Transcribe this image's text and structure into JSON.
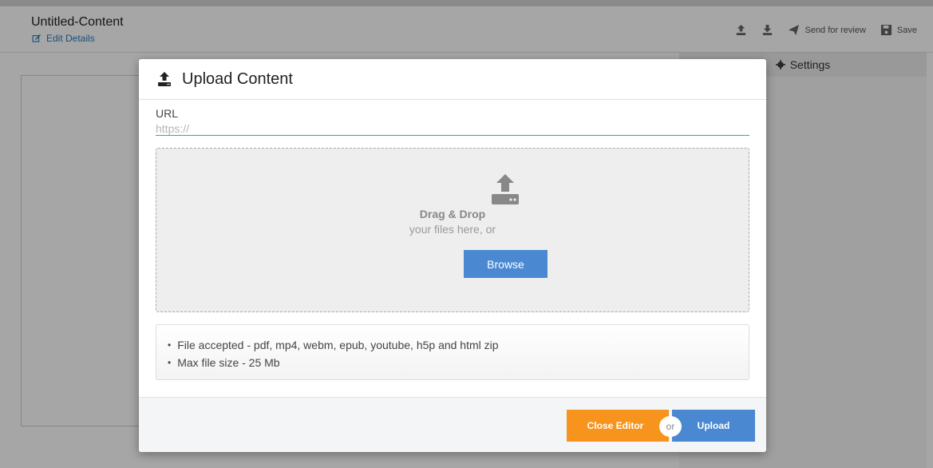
{
  "editor": {
    "title": "Untitled-Content",
    "edit_details": "Edit Details",
    "toolbar": {
      "upload_icon": "upload-icon",
      "download_icon": "download-icon",
      "send_for_review": "Send for review",
      "save": "Save"
    },
    "settings_label": "Settings"
  },
  "modal": {
    "title": "Upload Content",
    "url_label": "URL",
    "url_placeholder": "https://",
    "url_value": "",
    "dropzone": {
      "title": "Drag & Drop",
      "subtitle": "your files here, or",
      "browse_label": "Browse"
    },
    "info": [
      "File accepted - pdf, mp4, webm, epub, youtube, h5p and html zip",
      "Max file size - 25 Mb"
    ],
    "footer": {
      "close_label": "Close Editor",
      "or_label": "or",
      "upload_label": "Upload"
    }
  },
  "colors": {
    "accent_blue": "#4a89d1",
    "close_orange": "#f7941d",
    "link_blue": "#2b7bb9",
    "input_underline": "#2aa8b8"
  }
}
